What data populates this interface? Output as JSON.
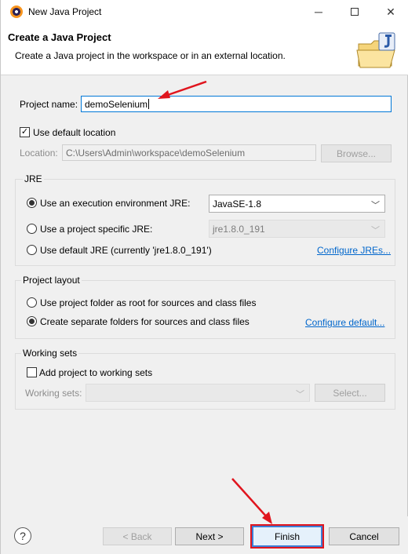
{
  "window": {
    "title": "New Java Project",
    "icon": "eclipse-icon",
    "controls": {
      "minimize": "─",
      "close": "✕"
    }
  },
  "banner": {
    "heading": "Create a Java Project",
    "description": "Create a Java project in the workspace or in an external location.",
    "icon": "java-folder-wizard-icon"
  },
  "project": {
    "name_label": "Project name:",
    "name_value": "demoSelenium"
  },
  "location": {
    "use_default_label": "Use default location",
    "use_default_checked": true,
    "label": "Location:",
    "value": "C:\\Users\\Admin\\workspace\\demoSelenium",
    "browse_label": "Browse..."
  },
  "jre": {
    "group_title": "JRE",
    "options": [
      {
        "label": "Use an execution environment JRE:",
        "checked": true
      },
      {
        "label": "Use a project specific JRE:",
        "checked": false
      },
      {
        "label": "Use default JRE (currently 'jre1.8.0_191')",
        "checked": false
      }
    ],
    "env_select": "JavaSE-1.8",
    "specific_select": "jre1.8.0_191",
    "configure_link": "Configure JREs..."
  },
  "layout": {
    "group_title": "Project layout",
    "options": [
      {
        "label": "Use project folder as root for sources and class files",
        "checked": false
      },
      {
        "label": "Create separate folders for sources and class files",
        "checked": true
      }
    ],
    "configure_link": "Configure default..."
  },
  "working_sets": {
    "group_title": "Working sets",
    "add_label": "Add project to working sets",
    "add_checked": false,
    "label": "Working sets:",
    "select_value": "",
    "select_button": "Select..."
  },
  "footer": {
    "help": "?",
    "back": "< Back",
    "next": "Next >",
    "finish": "Finish",
    "cancel": "Cancel"
  },
  "colors": {
    "annotation_red": "#e0151e",
    "link_blue": "#0066cc",
    "focus_blue": "#0078d7"
  }
}
